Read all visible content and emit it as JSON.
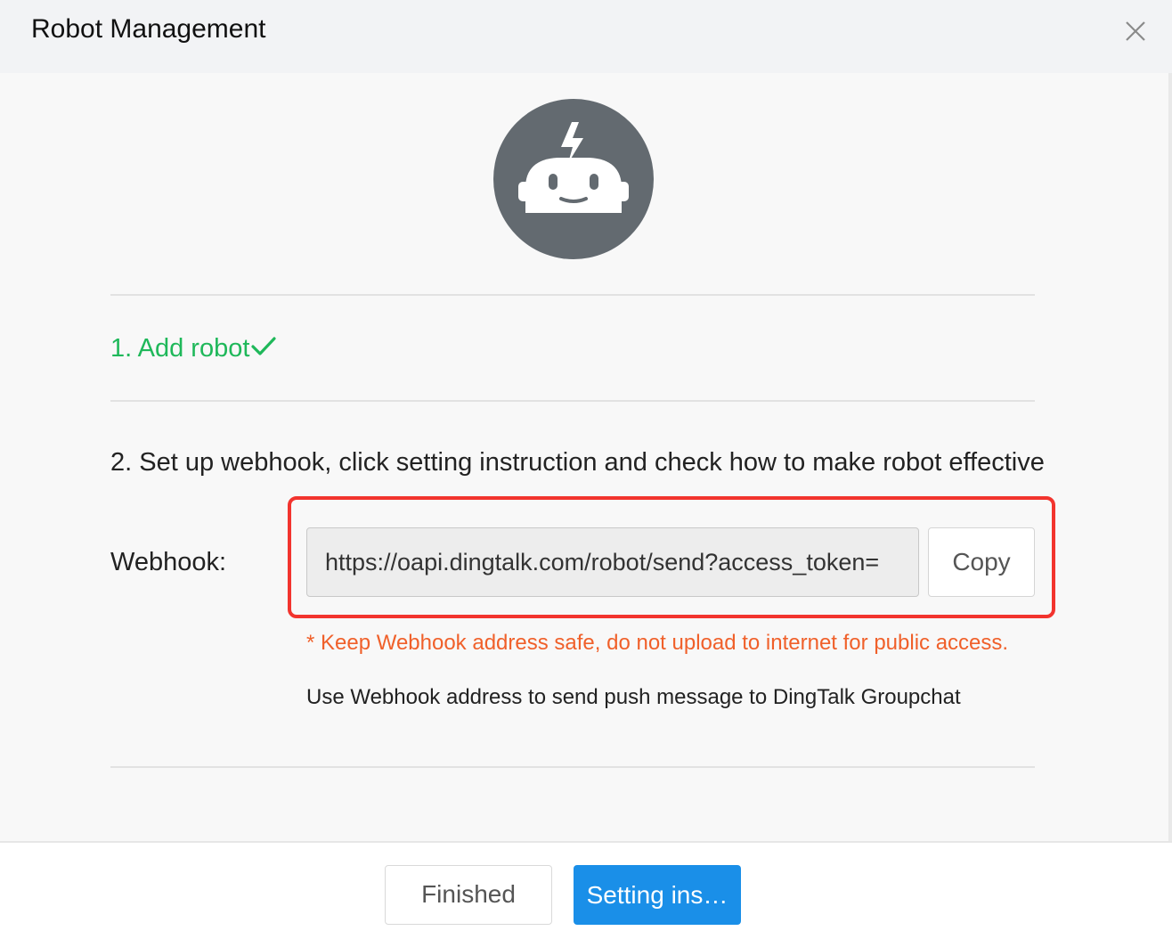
{
  "dialog": {
    "title": "Robot Management",
    "close_icon": "close-icon"
  },
  "robot_avatar": {
    "icon": "robot-icon",
    "bg_color": "#636a70"
  },
  "steps": {
    "step1_label": "1. Add robot",
    "step1_icon": "checkmark-icon",
    "step1_color": "#1fb85a",
    "step2_label": "2. Set up webhook, click setting instruction and check how to make robot effective"
  },
  "webhook": {
    "label": "Webhook:",
    "value": "https://oapi.dingtalk.com/robot/send?access_token=",
    "copy_label": "Copy",
    "warning": "* Keep Webhook address safe, do not upload to internet for public access.",
    "usage": "Use Webhook address to send push message to DingTalk Groupchat",
    "highlight_color": "#f2342e"
  },
  "footer": {
    "finished_label": "Finished",
    "setting_label": "Setting ins…",
    "primary_color": "#1a8fe8"
  }
}
